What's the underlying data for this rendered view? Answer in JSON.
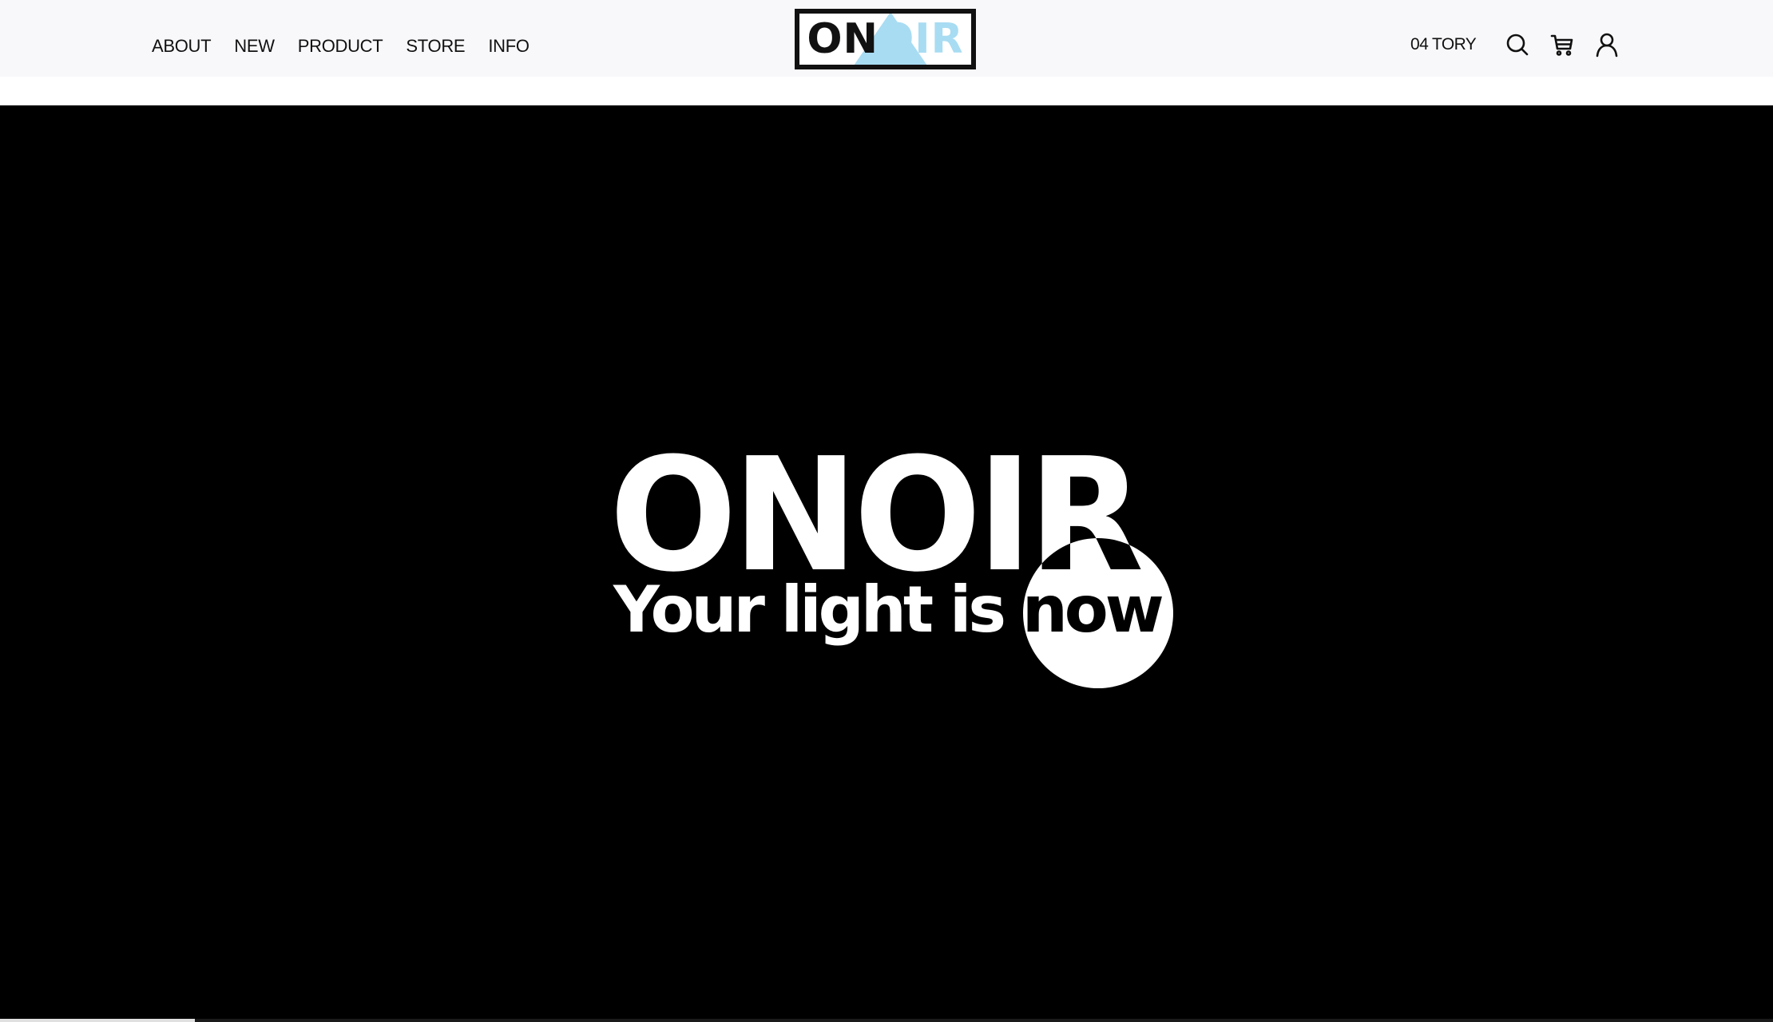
{
  "header": {
    "nav": [
      {
        "label": "ABOUT"
      },
      {
        "label": "NEW"
      },
      {
        "label": "PRODUCT"
      },
      {
        "label": "STORE"
      },
      {
        "label": "INFO"
      }
    ],
    "logo_text": "ONOIR",
    "story_label": "04 TORY",
    "icons": [
      "search-icon",
      "cart-icon",
      "user-icon"
    ]
  },
  "hero": {
    "title": "ONOIR",
    "tagline": "Your light is now",
    "background_color": "#000000",
    "text_color": "#ffffff"
  },
  "colors": {
    "accent": "#a8dcf2",
    "header_bg": "#f8f8fa"
  },
  "video": {
    "progress": 0.11
  }
}
